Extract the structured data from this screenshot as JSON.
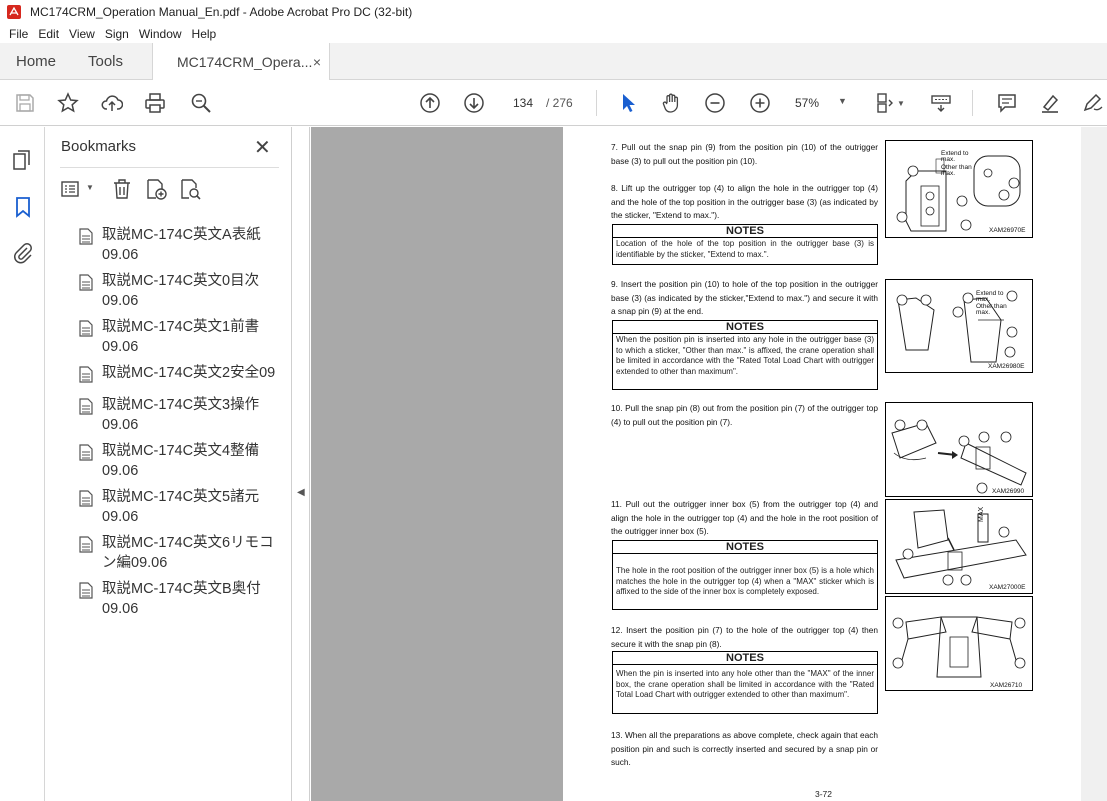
{
  "window": {
    "title": "MC174CRM_Operation Manual_En.pdf - Adobe Acrobat Pro DC (32-bit)"
  },
  "menu": [
    "File",
    "Edit",
    "View",
    "Sign",
    "Window",
    "Help"
  ],
  "tabs": {
    "home": "Home",
    "tools": "Tools",
    "document": "MC174CRM_Opera...",
    "close": "×"
  },
  "toolbar": {
    "page_current": "134",
    "page_total": "/  276",
    "zoom": "57%"
  },
  "bookmarks": {
    "title": "Bookmarks",
    "close": "✕",
    "items": [
      {
        "label": "取説MC-174C英文A表紙09.06"
      },
      {
        "label": "取説MC-174C英文0目次09.06"
      },
      {
        "label": "取説MC-174C英文1前書09.06"
      },
      {
        "label": "取説MC-174C英文2安全09"
      },
      {
        "label": "取説MC-174C英文3操作09.06"
      },
      {
        "label": "取説MC-174C英文4整備09.06"
      },
      {
        "label": "取説MC-174C英文5諸元09.06"
      },
      {
        "label": "取説MC-174C英文6リモコン編09.06"
      },
      {
        "label": "取説MC-174C英文B奥付09.06"
      }
    ]
  },
  "page": {
    "steps": {
      "s7": "7.  Pull out the snap pin (9) from the position pin (10) of the outrigger base (3) to pull out the position pin (10).",
      "s8": "8. Lift up the outrigger top (4) to align the hole in the outrigger top (4) and the hole of the top position in the outrigger base (3) (as indicated by the sticker, \"Extend to max.\").",
      "s9": "9.  Insert the position pin (10) to hole of the top position in the outrigger base (3) (as indicated by the sticker,\"Extend to max.\") and secure it with a snap pin (9) at the end.",
      "s10": "10.  Pull the snap pin (8) out from the position pin (7) of the outrigger top (4) to pull out the position pin (7).",
      "s11": "11. Pull out the outrigger inner box (5) from the outrigger top (4) and align the hole in the outrigger top (4) and the hole in the root position of the outrigger inner box (5).",
      "s12": "12. Insert the position pin (7) to the hole of the outrigger top (4) then secure it with the snap pin (8).",
      "s13": "13. When all the preparations as above complete, check again that each position pin and such is correctly inserted and secured by a snap pin or such."
    },
    "notes_label": "NOTES",
    "notes": {
      "n1": "Location of the hole of the top position in the outrigger base (3) is identifiable by the sticker, \"Extend to max.\".",
      "n2": "When the position pin is inserted into any hole in the outrigger base (3) to which a sticker, \"Other than max.\" is affixed, the crane operation shall be limited in accordance with the \"Rated Total Load Chart with outrigger extended to other than maximum\".",
      "n3": "The hole in the root position of the outrigger inner box (5) is a hole which matches the hole in the outrigger top (4) when a \"MAX\" sticker which is affixed to the side of the inner box is completely exposed.",
      "n4": "When the pin is inserted into any hole other than the \"MAX\" of the inner box, the crane operation shall be limited in accordance with the \"Rated Total Load Chart with outrigger extended to other than maximum\"."
    },
    "figures": {
      "f1": "XAM26970E",
      "f2": "XAM26980E",
      "f3": "XAM26990",
      "f4": "XAM27000E",
      "f5": "XAM26710"
    },
    "fig_labels": {
      "extend": "Extend to max.",
      "other": "Other than max.",
      "max": "MAX"
    },
    "page_number": "3-72"
  }
}
